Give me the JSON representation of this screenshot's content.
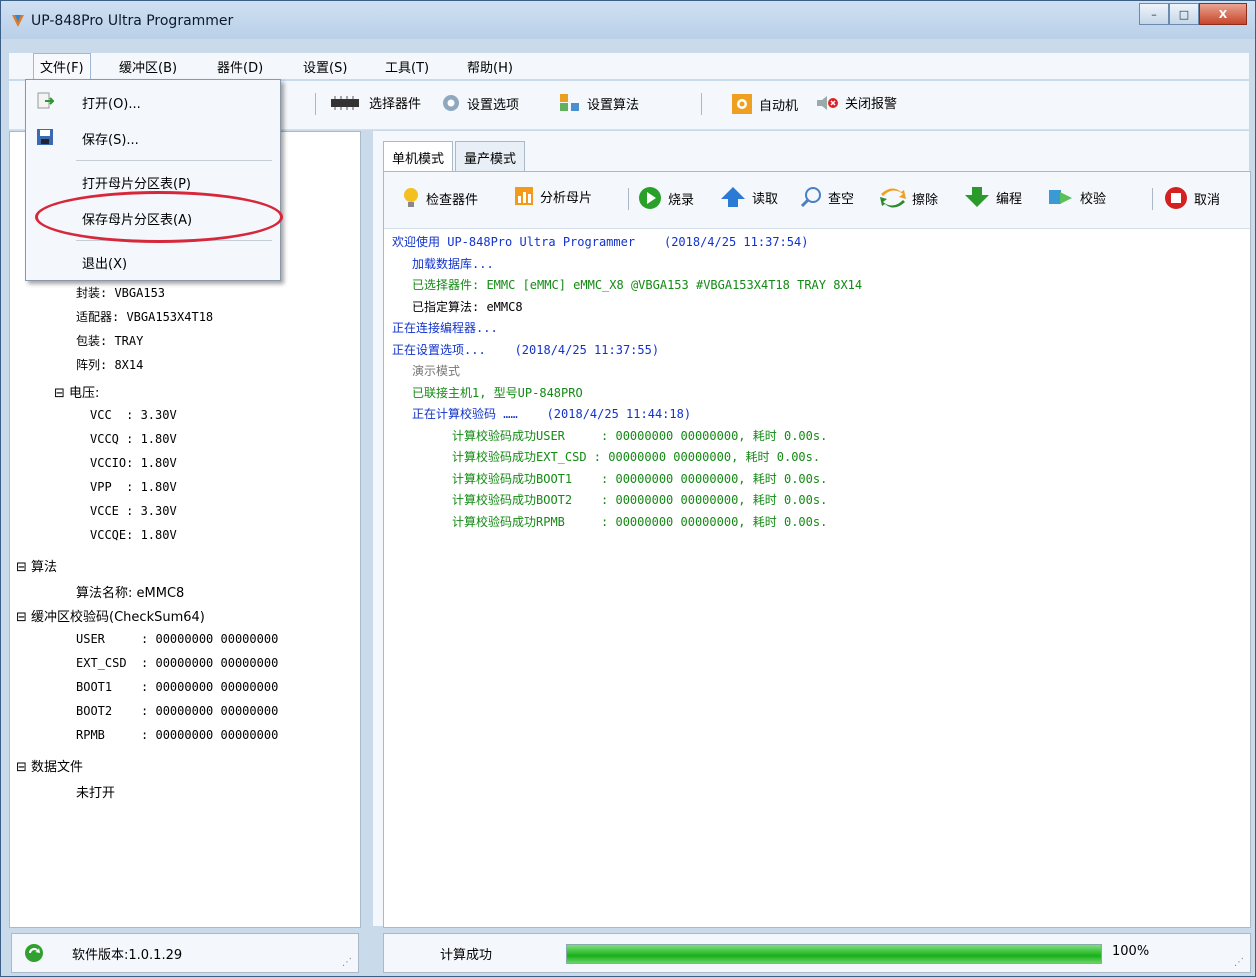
{
  "window": {
    "title": "UP-848Pro Ultra Programmer",
    "minimize": "–",
    "maximize": "□",
    "close": "X"
  },
  "menubar": {
    "items": [
      "文件(F)",
      "缓冲区(B)",
      "器件(D)",
      "设置(S)",
      "工具(T)",
      "帮助(H)"
    ]
  },
  "toolbar": {
    "select_device": "选择器件",
    "set_options": "设置选项",
    "set_algorithm": "设置算法",
    "auto_machine": "自动机",
    "close_alarm": "关闭报警"
  },
  "file_menu": {
    "open": "打开(O)...",
    "save": "保存(S)...",
    "open_partition": "打开母片分区表(P)",
    "save_partition": "保存母片分区表(A)",
    "exit": "退出(X)"
  },
  "tree": {
    "package": "封装: VBGA153",
    "adapter": "适配器: VBGA153X4T18",
    "packing": "包装: TRAY",
    "array": "阵列: 8X14",
    "voltage": "电压:",
    "vcc": "VCC  : 3.30V",
    "vccq": "VCCQ : 1.80V",
    "vccio": "VCCIO: 1.80V",
    "vpp": "VPP  : 1.80V",
    "vcce": "VCCE : 3.30V",
    "vccqe": "VCCQE: 1.80V",
    "algorithm": "算法",
    "algorithm_name": "算法名称: eMMC8",
    "checksum": "缓冲区校验码(CheckSum64)",
    "user": "USER     : 00000000 00000000",
    "ext_csd": "EXT_CSD  : 00000000 00000000",
    "boot1": "BOOT1    : 00000000 00000000",
    "boot2": "BOOT2    : 00000000 00000000",
    "rpmb": "RPMB     : 00000000 00000000",
    "data_file": "数据文件",
    "not_opened": "未打开"
  },
  "tabs": [
    "单机模式",
    "量产模式"
  ],
  "actions": {
    "check_device": "检查器件",
    "analyze_master": "分析母片",
    "burn": "烧录",
    "read": "读取",
    "blank_check": "查空",
    "erase": "擦除",
    "program": "编程",
    "verify": "校验",
    "cancel": "取消"
  },
  "log": [
    {
      "text": "欢迎使用 UP-848Pro Ultra Programmer    (2018/4/25 11:37:54)",
      "color": "blue",
      "indent": 0
    },
    {
      "text": "加载数据库...",
      "color": "blue",
      "indent": 1
    },
    {
      "text": "已选择器件: EMMC [eMMC] eMMC_X8 @VBGA153 #VBGA153X4T18 TRAY 8X14",
      "color": "green",
      "indent": 1
    },
    {
      "text": "已指定算法: eMMC8",
      "color": "black",
      "indent": 1
    },
    {
      "text": "正在连接编程器...",
      "color": "blue",
      "indent": 0
    },
    {
      "text": "正在设置选项...    (2018/4/25 11:37:55)",
      "color": "blue",
      "indent": 0
    },
    {
      "text": "演示模式",
      "color": "gray",
      "indent": 1
    },
    {
      "text": "已联接主机1, 型号UP-848PRO",
      "color": "green",
      "indent": 1
    },
    {
      "text": "正在计算校验码 ……    (2018/4/25 11:44:18)",
      "color": "blue",
      "indent": 1
    },
    {
      "text": "计算校验码成功USER     : 00000000 00000000, 耗时 0.00s.",
      "color": "green",
      "indent": 2
    },
    {
      "text": "计算校验码成功EXT_CSD : 00000000 00000000, 耗时 0.00s.",
      "color": "green",
      "indent": 2
    },
    {
      "text": "计算校验码成功BOOT1    : 00000000 00000000, 耗时 0.00s.",
      "color": "green",
      "indent": 2
    },
    {
      "text": "计算校验码成功BOOT2    : 00000000 00000000, 耗时 0.00s.",
      "color": "green",
      "indent": 2
    },
    {
      "text": "计算校验码成功RPMB     : 00000000 00000000, 耗时 0.00s.",
      "color": "green",
      "indent": 2
    }
  ],
  "status": {
    "version": "软件版本:1.0.1.29",
    "result": "计算成功",
    "progress_label": "100%",
    "progress": 1.0
  },
  "colors": {
    "highlight_ellipse": "#d6283a",
    "log_blue": "#1133cc",
    "log_green": "#138a13"
  }
}
